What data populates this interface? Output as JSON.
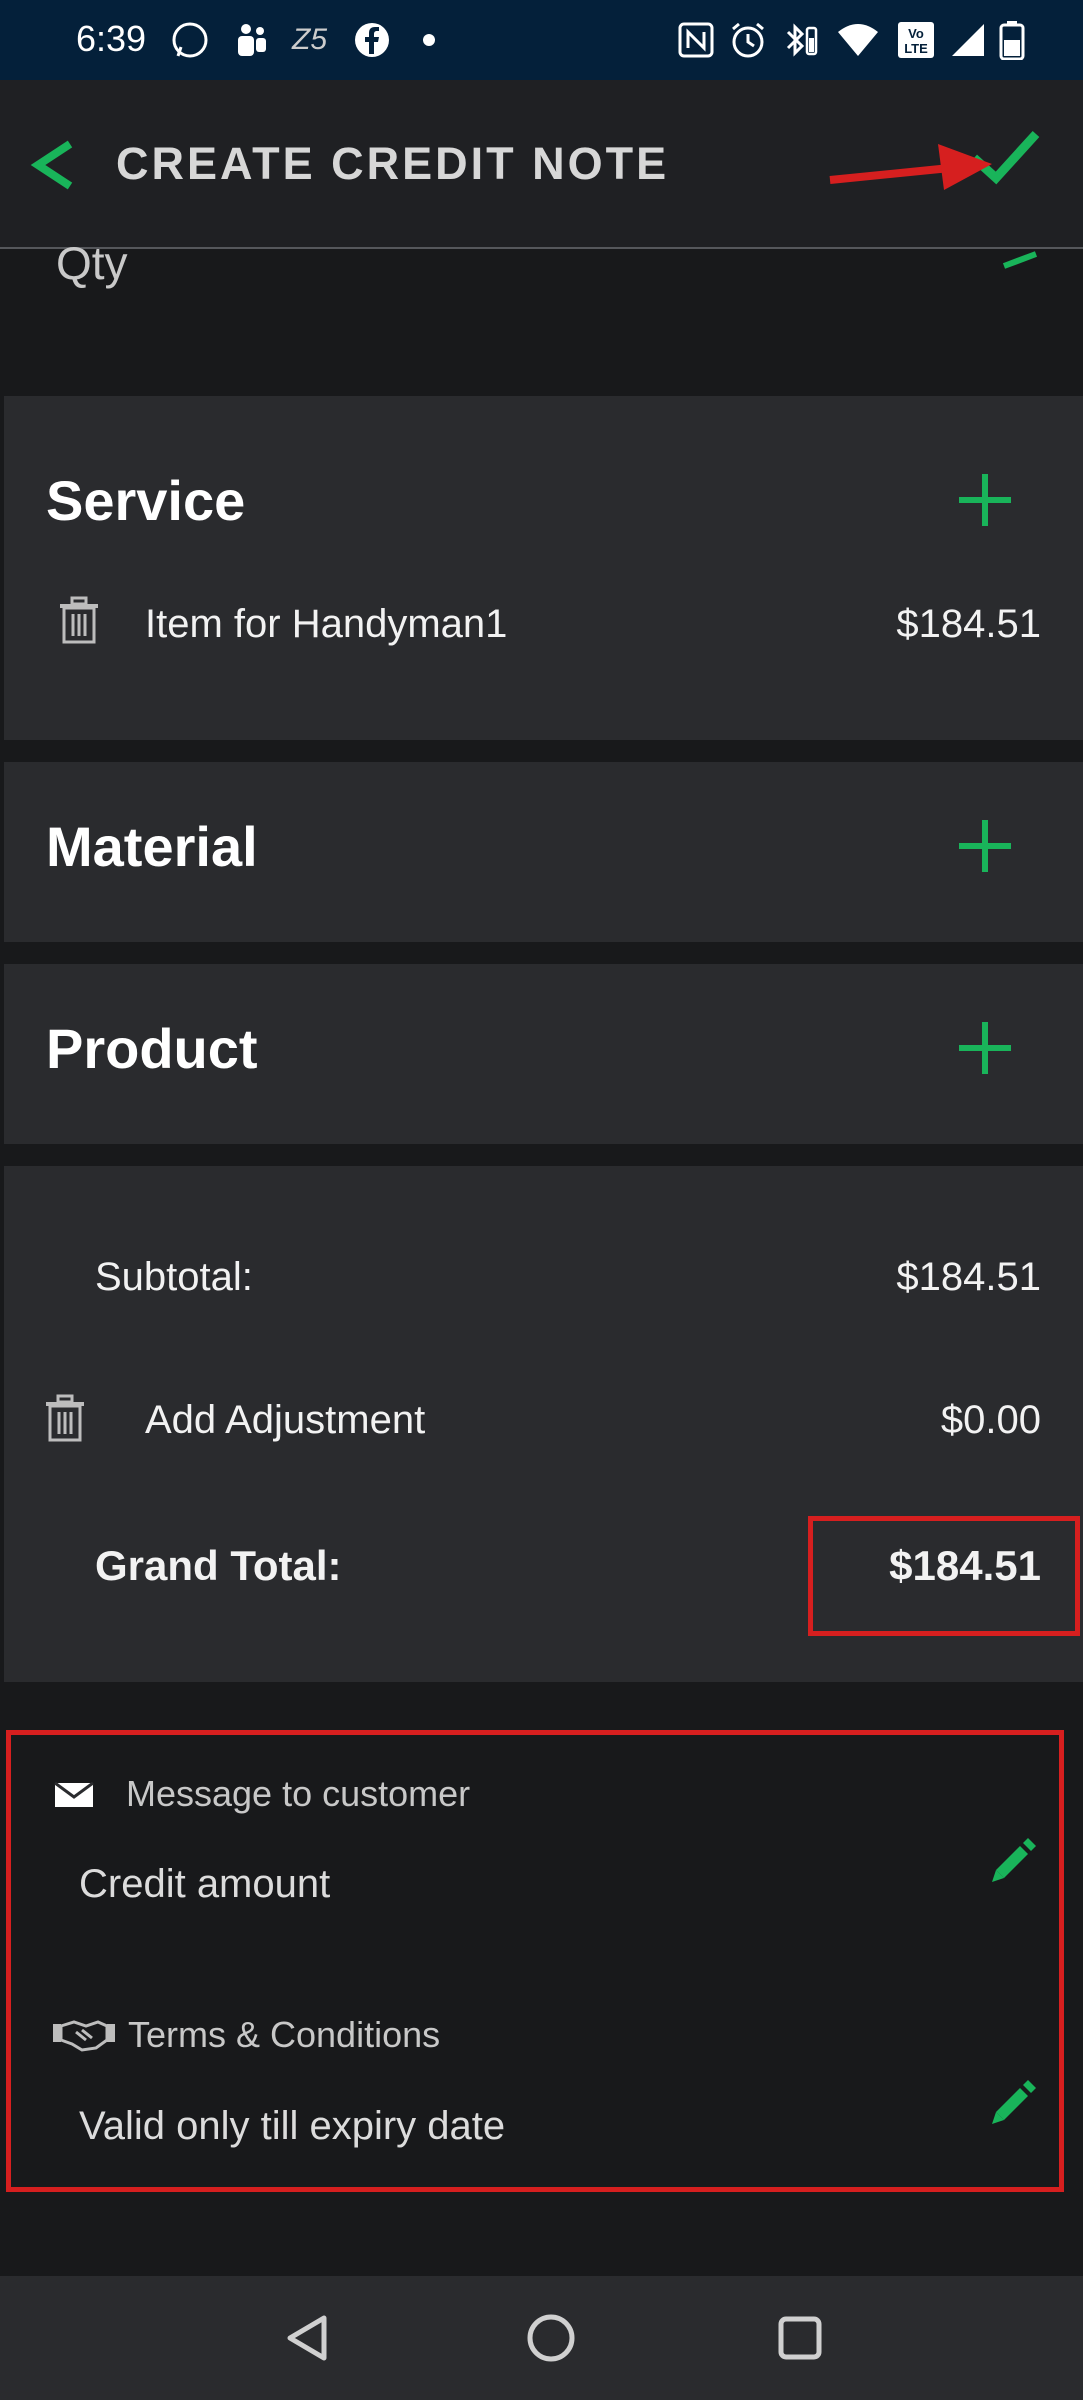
{
  "status_bar": {
    "time": "6:39"
  },
  "app_bar": {
    "title": "CREATE CREDIT NOTE"
  },
  "qty": {
    "label": "Qty"
  },
  "service": {
    "title": "Service",
    "items": [
      {
        "name": "Item for Handyman1",
        "price": "$184.51"
      }
    ]
  },
  "material": {
    "title": "Material"
  },
  "product": {
    "title": "Product"
  },
  "totals": {
    "subtotal_label": "Subtotal:",
    "subtotal_value": "$184.51",
    "adjustment_label": "Add Adjustment",
    "adjustment_value": "$0.00",
    "grand_total_label": "Grand Total:",
    "grand_total_value": "$184.51"
  },
  "notes": {
    "message_title": "Message to customer",
    "message_value": "Credit amount",
    "terms_title": "Terms & Conditions",
    "terms_value": "Valid only till expiry date"
  },
  "colors": {
    "accent_green": "#19b45a",
    "annotation_red": "#d61f1f",
    "card_bg": "#2a2b2e",
    "page_bg": "#18191b"
  }
}
